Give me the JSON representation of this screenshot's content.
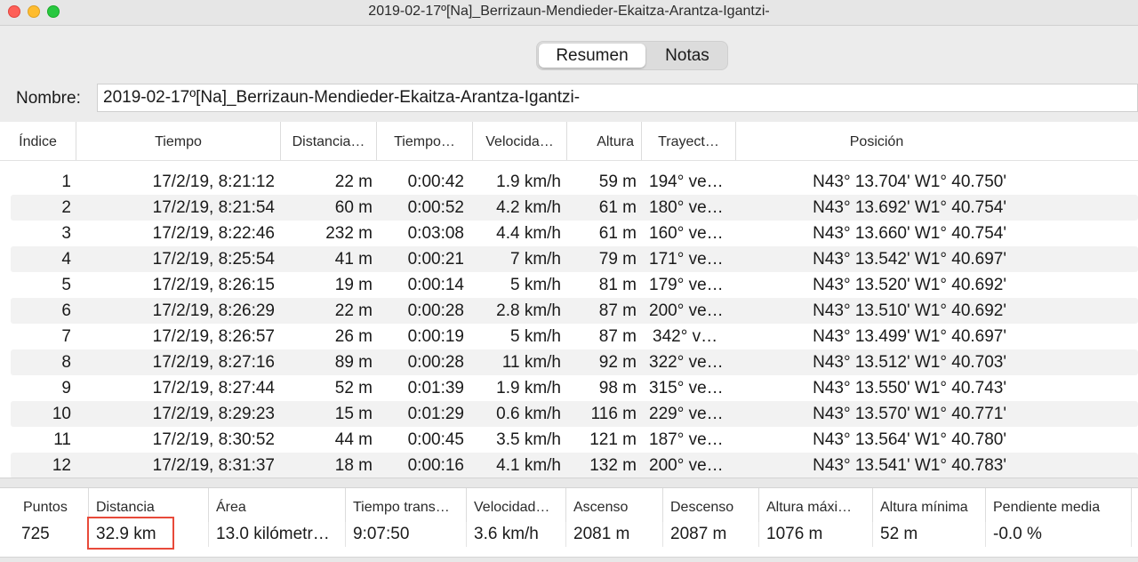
{
  "window": {
    "title": "2019-02-17º[Na]_Berrizaun-Mendieder-Ekaitza-Arantza-Igantzi-"
  },
  "tabs": {
    "resumen": "Resumen",
    "notas": "Notas"
  },
  "name": {
    "label": "Nombre:",
    "value": "2019-02-17º[Na]_Berrizaun-Mendieder-Ekaitza-Arantza-Igantzi-"
  },
  "table": {
    "headers": [
      "Índice",
      "Tiempo",
      "Distancia…",
      "Tiempo…",
      "Velocida…",
      "Altura",
      "Trayect…",
      "Posición"
    ],
    "rows": [
      [
        "1",
        "17/2/19, 8:21:12",
        "22 m",
        "0:00:42",
        "1.9 km/h",
        "59 m",
        "194° ve…",
        "N43° 13.704' W1° 40.750'"
      ],
      [
        "2",
        "17/2/19, 8:21:54",
        "60 m",
        "0:00:52",
        "4.2 km/h",
        "61 m",
        "180° ve…",
        "N43° 13.692' W1° 40.754'"
      ],
      [
        "3",
        "17/2/19, 8:22:46",
        "232 m",
        "0:03:08",
        "4.4 km/h",
        "61 m",
        "160° ve…",
        "N43° 13.660' W1° 40.754'"
      ],
      [
        "4",
        "17/2/19, 8:25:54",
        "41 m",
        "0:00:21",
        "7 km/h",
        "79 m",
        "171° ve…",
        "N43° 13.542' W1° 40.697'"
      ],
      [
        "5",
        "17/2/19, 8:26:15",
        "19 m",
        "0:00:14",
        "5 km/h",
        "81 m",
        "179° ve…",
        "N43° 13.520' W1° 40.692'"
      ],
      [
        "6",
        "17/2/19, 8:26:29",
        "22 m",
        "0:00:28",
        "2.8 km/h",
        "87 m",
        "200° ve…",
        "N43° 13.510' W1° 40.692'"
      ],
      [
        "7",
        "17/2/19, 8:26:57",
        "26 m",
        "0:00:19",
        "5 km/h",
        "87 m",
        "342° v…",
        "N43° 13.499' W1° 40.697'"
      ],
      [
        "8",
        "17/2/19, 8:27:16",
        "89 m",
        "0:00:28",
        "11 km/h",
        "92 m",
        "322° ve…",
        "N43° 13.512' W1° 40.703'"
      ],
      [
        "9",
        "17/2/19, 8:27:44",
        "52 m",
        "0:01:39",
        "1.9 km/h",
        "98 m",
        "315° ve…",
        "N43° 13.550' W1° 40.743'"
      ],
      [
        "10",
        "17/2/19, 8:29:23",
        "15 m",
        "0:01:29",
        "0.6 km/h",
        "116 m",
        "229° ve…",
        "N43° 13.570' W1° 40.771'"
      ],
      [
        "11",
        "17/2/19, 8:30:52",
        "44 m",
        "0:00:45",
        "3.5 km/h",
        "121 m",
        "187° ve…",
        "N43° 13.564' W1° 40.780'"
      ],
      [
        "12",
        "17/2/19, 8:31:37",
        "18 m",
        "0:00:16",
        "4.1 km/h",
        "132 m",
        "200° ve…",
        "N43° 13.541' W1° 40.783'"
      ]
    ]
  },
  "summary": {
    "headers": [
      "Puntos",
      "Distancia",
      "Área",
      "Tiempo trans…",
      "Velocidad…",
      "Ascenso",
      "Descenso",
      "Altura máxi…",
      "Altura mínima",
      "Pendiente media"
    ],
    "values": [
      "725",
      "32.9 km",
      "13.0 kilómetr…",
      "9:07:50",
      "3.6 km/h",
      "2081 m",
      "2087 m",
      "1076 m",
      "52 m",
      "-0.0 %"
    ]
  },
  "colors": {
    "highlight": "#e84a3a"
  }
}
